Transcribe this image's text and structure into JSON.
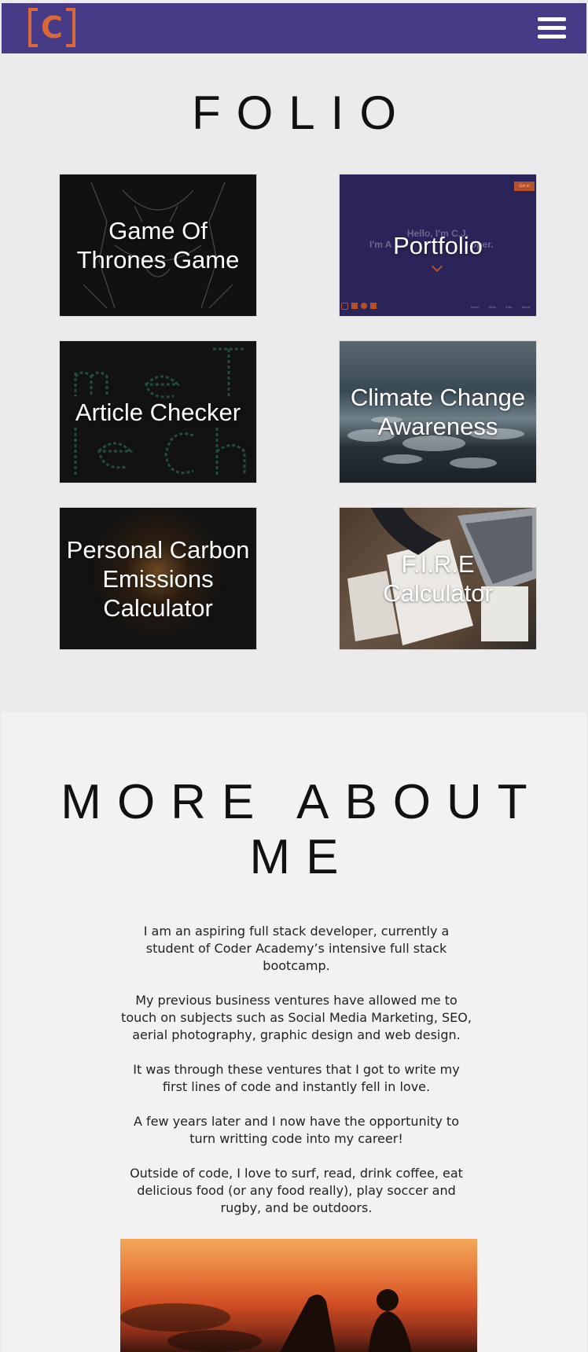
{
  "nav": {
    "logo_letter": "C",
    "menu_icon": "hamburger-menu-icon"
  },
  "folio": {
    "title": "FOLIO",
    "projects": [
      {
        "label": "Game Of Thrones Game"
      },
      {
        "label": "Portfolio"
      },
      {
        "label": "Article Checker"
      },
      {
        "label": "Climate Change Awareness"
      },
      {
        "label": "Personal Carbon Emissions Calculator"
      },
      {
        "label": "F.I.R.E Calculator"
      }
    ]
  },
  "portfolio_preview": {
    "hero_text_1": "Hello, I'm C.J.",
    "hero_text_2": "I'm A",
    "hero_text_3": "oper.",
    "button": "Get in",
    "footer_links": [
      "Home",
      "Skills",
      "Folio",
      "About"
    ]
  },
  "about": {
    "title": "MORE ABOUT ME",
    "paragraphs": [
      "I am an aspiring full stack developer, currently a student of Coder Academy’s intensive full stack bootcamp.",
      "My previous business ventures have allowed me to touch on subjects such as Social Media Marketing, SEO, aerial photography, graphic design and web design.",
      "It was through these ventures that I got to write my first lines of code and instantly fell in love.",
      "A few years later and I now have the opportunity to turn writting code into my career!",
      "Outside of code, I love to surf, read, drink coffee, eat delicious food (or any food really), play soccer and rugby, and be outdoors."
    ]
  },
  "colors": {
    "nav_bg": "#473a87",
    "logo": "#d9683b",
    "folio_bg": "#ebebeb",
    "about_bg": "#f2f2f2"
  }
}
